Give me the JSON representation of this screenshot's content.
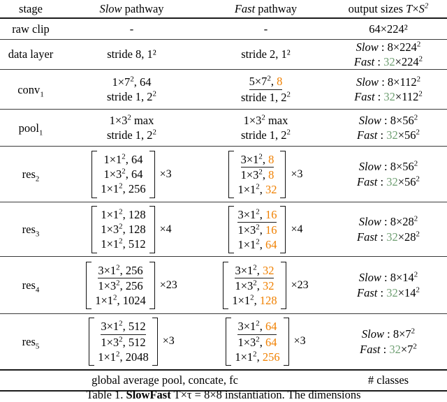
{
  "table": {
    "header": {
      "stage": "stage",
      "slow": "Slow pathway",
      "slow_italic": "Slow",
      "slow_rest": " pathway",
      "fast_italic": "Fast",
      "fast_rest": " pathway",
      "output": "output sizes T×S²",
      "output_prefix": "output sizes ",
      "output_T": "T",
      "output_times": "×",
      "output_S": "S",
      "output_S_exp": "2"
    },
    "rows": [
      {
        "stage": "raw clip",
        "slow": "-",
        "fast": "-",
        "output": [
          "64×224²"
        ]
      },
      {
        "stage": "data layer",
        "slow": [
          "stride 8, 1²"
        ],
        "fast": [
          "stride 2, 1²"
        ],
        "output": [
          "Slow : 8×224²",
          "Fast : 32×224²"
        ],
        "output_fast_highlight": "32"
      },
      {
        "stage": "conv₁",
        "slow": [
          "1×7², 64",
          "stride 1, 2²"
        ],
        "fast": [
          "5×7², 8",
          "stride 1, 2²"
        ],
        "fast_highlight": "8",
        "output": [
          "Slow : 8×112²",
          "Fast : 32×112²"
        ],
        "output_fast_highlight": "32"
      },
      {
        "stage": "pool₁",
        "slow": [
          "1×3² max",
          "stride 1, 2²"
        ],
        "fast": [
          "1×3² max",
          "stride 1, 2²"
        ],
        "output": [
          "Slow : 8×56²",
          "Fast : 32×56²"
        ],
        "output_fast_highlight": "32"
      },
      {
        "stage": "res₂",
        "slow_block": [
          "1×1², 64",
          "1×3², 64",
          "1×1², 256"
        ],
        "slow_mult": "×3",
        "fast_block": [
          "3×1², 8",
          "1×3², 8",
          "1×1², 32"
        ],
        "fast_block_values": [
          "8",
          "8",
          "32"
        ],
        "fast_mult": "×3",
        "output": [
          "Slow : 8×56²",
          "Fast : 32×56²"
        ],
        "output_fast_highlight": "32"
      },
      {
        "stage": "res₃",
        "slow_block": [
          "1×1², 128",
          "1×3², 128",
          "1×1², 512"
        ],
        "slow_mult": "×4",
        "fast_block": [
          "3×1², 16",
          "1×3², 16",
          "1×1², 64"
        ],
        "fast_block_values": [
          "16",
          "16",
          "64"
        ],
        "fast_mult": "×4",
        "output": [
          "Slow : 8×28²",
          "Fast : 32×28²"
        ],
        "output_fast_highlight": "32"
      },
      {
        "stage": "res₄",
        "slow_block": [
          "3×1², 256",
          "1×3², 256",
          "1×1², 1024"
        ],
        "slow_mult": "×23",
        "fast_block": [
          "3×1², 32",
          "1×3², 32",
          "1×1², 128"
        ],
        "fast_block_values": [
          "32",
          "32",
          "128"
        ],
        "fast_mult": "×23",
        "output": [
          "Slow : 8×14²",
          "Fast : 32×14²"
        ],
        "output_fast_highlight": "32"
      },
      {
        "stage": "res₅",
        "slow_block": [
          "3×1², 512",
          "1×3², 512",
          "1×1², 2048"
        ],
        "slow_mult": "×3",
        "fast_block": [
          "3×1², 64",
          "1×3², 64",
          "1×1², 256"
        ],
        "fast_block_values": [
          "64",
          "64",
          "256"
        ],
        "fast_mult": "×3",
        "output": [
          "Slow : 8×7²",
          "Fast : 32×7²"
        ],
        "output_fast_highlight": "32"
      }
    ],
    "footer": {
      "merged": "global average pool, concate, fc",
      "output": "# classes"
    }
  },
  "caption": {
    "label": "Table 1.",
    "bold_title": "SlowFast",
    "text": " T×τ = 8×8 instantiation. The dimensions",
    "full": "Table 1. SlowFast T×τ = 8×8 instantiation. The dimensions"
  },
  "colors": {
    "fast_channel_orange": "#F08000",
    "fast_temporal_green": "#6f9f72",
    "rule": "#1a1a1a"
  }
}
